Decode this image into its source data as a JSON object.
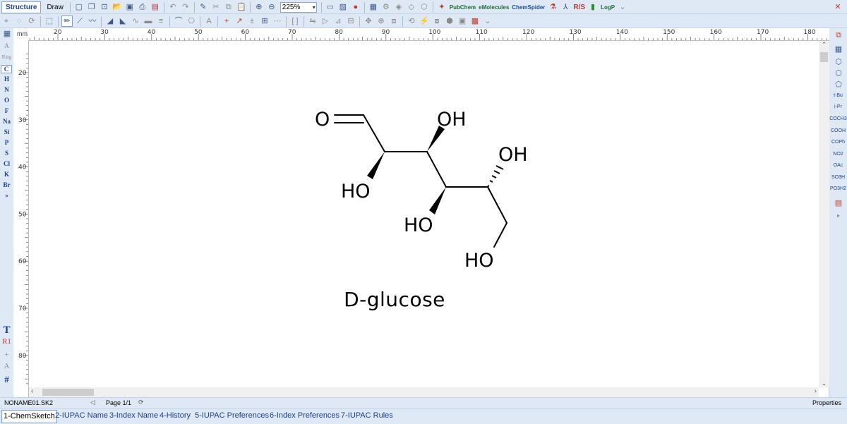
{
  "toolbar": {
    "structure_tab": "Structure",
    "draw_tab": "Draw",
    "zoom_value": "225%",
    "icons_row1": [
      "new-icon",
      "new-page-icon",
      "open-template-icon",
      "open-icon",
      "save-icon",
      "print-icon",
      "pdf-icon",
      "undo-icon",
      "redo-icon",
      "clean-icon",
      "cut-icon",
      "copy-icon",
      "paste-icon",
      "zoom-in-icon",
      "zoom-out-icon"
    ],
    "pubchem_label": "PubChem",
    "emolecules_label": "eMolecules",
    "chemspider_label": "ChemSpider",
    "rs_label": "R/S",
    "logp_label": "LogP"
  },
  "left_panel": {
    "items": [
      "A",
      "Ring",
      "C",
      "H",
      "N",
      "O",
      "F",
      "Na",
      "Si",
      "P",
      "S",
      "Cl",
      "K",
      "Br",
      "»"
    ],
    "bottom_items": [
      "T",
      "R1",
      "+",
      "A",
      "#"
    ]
  },
  "right_panel": {
    "items": [
      "t-Bu",
      "i-Pr",
      "COCH3",
      "COOH",
      "COPh",
      "NO2",
      "OAc",
      "SO3H",
      "PO3H2"
    ]
  },
  "ruler": {
    "unit": "mm",
    "h_labels": [
      "20",
      "30",
      "40",
      "50",
      "60",
      "70",
      "80",
      "90",
      "100",
      "110",
      "120",
      "130",
      "140",
      "150",
      "160",
      "170",
      "180"
    ],
    "v_labels": [
      "20",
      "30",
      "40",
      "50",
      "60",
      "70",
      "80"
    ]
  },
  "molecule": {
    "name": "D-glucose",
    "labels": [
      "O",
      "OH",
      "OH",
      "HO",
      "HO",
      "HO"
    ]
  },
  "status": {
    "file": "NONAME01.SK2",
    "page": "Page 1/1",
    "properties": "Properties"
  },
  "tabs": [
    "1-ChemSketch",
    "2-IUPAC Name",
    "3-Index Name",
    "4-History",
    "5-IUPAC Preferences",
    "6-Index Preferences",
    "7-IUPAC Rules"
  ]
}
